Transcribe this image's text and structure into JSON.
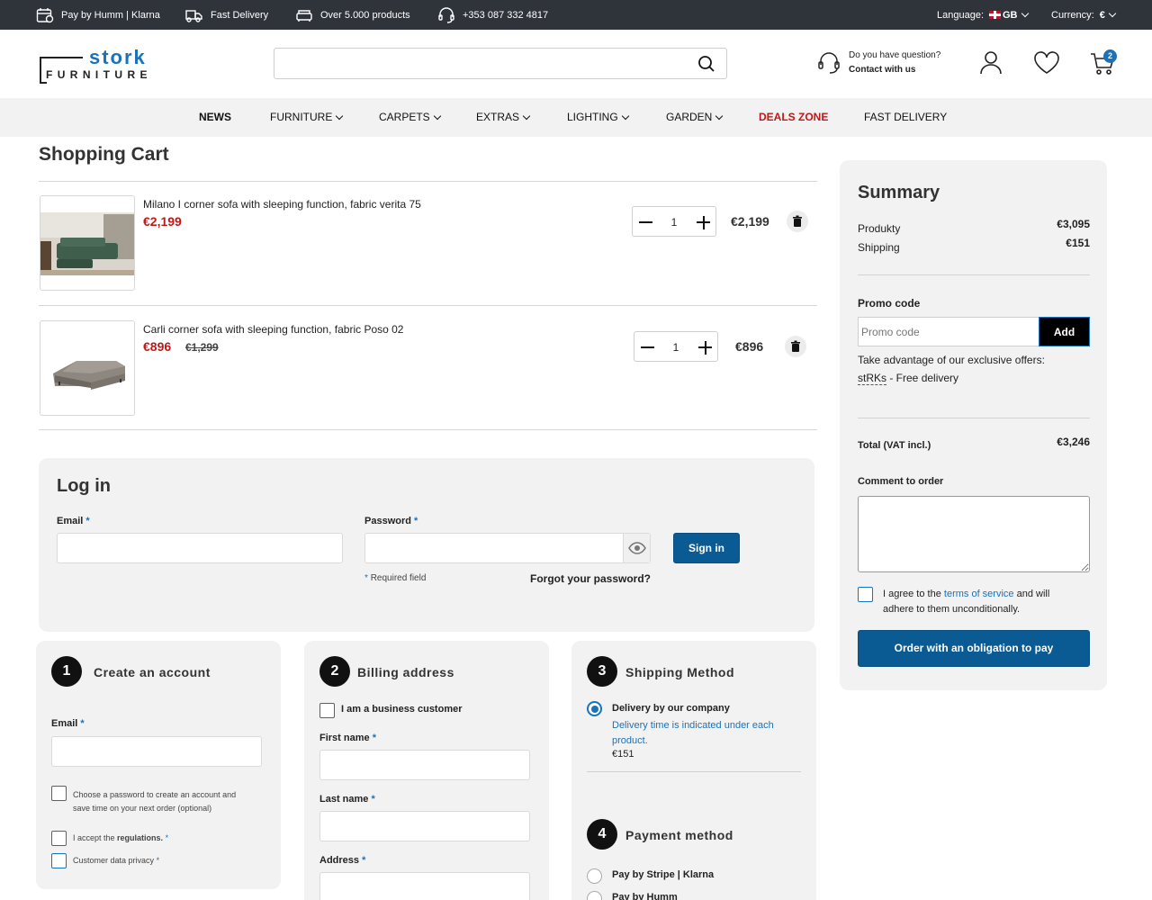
{
  "topbar": {
    "pay": "Pay by Humm | Klarna",
    "delivery": "Fast Delivery",
    "products": "Over 5.000 products",
    "phone": "+353 087 332 4817",
    "language_label": "Language:",
    "language_value": "GB",
    "currency_label": "Currency:",
    "currency_value": "€"
  },
  "header": {
    "logo_top": "stork",
    "logo_bottom": "FURNITURE",
    "search_placeholder": "",
    "help_question": "Do you have question?",
    "help_contact": "Contact with us",
    "cart_count": "2"
  },
  "nav": [
    "NEWS",
    "FURNITURE",
    "CARPETS",
    "EXTRAS",
    "LIGHTING",
    "GARDEN",
    "DEALS ZONE",
    "FAST DELIVERY"
  ],
  "cart": {
    "title": "Shopping Cart",
    "items": [
      {
        "name": "Milano I corner sofa with sleeping function, fabric verita 75",
        "price": "€2,199",
        "old_price": "",
        "qty": "1",
        "total": "€2,199"
      },
      {
        "name": "Carli corner sofa with sleeping function, fabric Poso 02",
        "price": "€896",
        "old_price": "€1,299",
        "qty": "1",
        "total": "€896"
      }
    ]
  },
  "login": {
    "title": "Log in",
    "email_label": "Email",
    "password_label": "Password",
    "sign_in": "Sign in",
    "required_note": "Required field",
    "forgot": "Forgot your password?",
    "asterisk": "*"
  },
  "steps": {
    "account": {
      "num": "1",
      "title": "Create an account",
      "email_label": "Email",
      "choose_password_1": "Choose a password to create an account and",
      "choose_password_2": "save time on your next order (optional)",
      "accept_prefix": "I accept the",
      "accept_link": "regulations.",
      "privacy": "Customer data privacy"
    },
    "billing": {
      "num": "2",
      "title": "Billing address",
      "business": "I am a business customer",
      "first_name": "First name",
      "last_name": "Last name",
      "address": "Address"
    },
    "shipping": {
      "num": "3",
      "title": "Shipping Method",
      "option": "Delivery by our company",
      "note_1": "Delivery time is indicated under each",
      "note_2": "product.",
      "price": "€151"
    },
    "payment": {
      "num": "4",
      "title": "Payment method",
      "option1": "Pay by Stripe | Klarna",
      "option2": "Pay by Humm"
    }
  },
  "summary": {
    "title": "Summary",
    "products_label": "Produkty",
    "products_value": "€3,095",
    "shipping_label": "Shipping",
    "shipping_value": "€151",
    "promo_label": "Promo code",
    "promo_placeholder": "Promo code",
    "promo_button": "Add",
    "offers_text": "Take advantage of our exclusive offers:",
    "offer_code": "stRKs",
    "offer_desc": " - Free delivery",
    "total_label": "Total (VAT incl.)",
    "total_value": "€3,246",
    "comment_label": "Comment to order",
    "agree_prefix": "I agree to the ",
    "agree_link": "terms of service",
    "agree_suffix": " and will",
    "agree_line2": "adhere to them unconditionally.",
    "order_button": "Order with an obligation to pay"
  },
  "colors": {
    "accent": "#1a72b8",
    "sale": "#c01818",
    "dark": "#2f333a",
    "button": "#0a5a93"
  },
  "icons": [
    "calendar-card-icon",
    "truck-icon",
    "sofa-icon",
    "headset-icon",
    "search-icon",
    "user-icon",
    "heart-icon",
    "cart-icon",
    "trash-icon",
    "eye-icon"
  ]
}
